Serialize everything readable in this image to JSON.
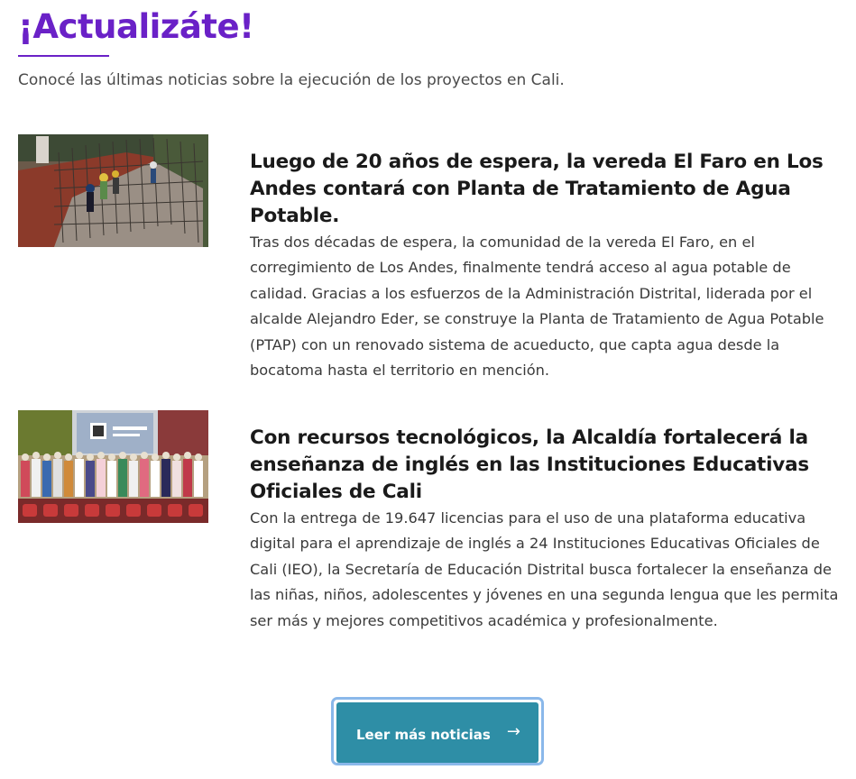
{
  "section": {
    "title": "¡Actualizáte!",
    "subtitle": "Conocé las últimas noticias sobre la ejecución de los proyectos en Cali."
  },
  "news": [
    {
      "title": "Luego de 20 años de espera, la vereda El Faro en Los Andes contará con Planta de Tratamiento de Agua Potable.",
      "body": "Tras dos décadas de espera, la comunidad de la vereda El Faro, en el corregimiento de Los Andes, finalmente tendrá acceso al agua potable de calidad. Gracias a los esfuerzos de la Administración Distrital, liderada por el alcalde Alejandro Eder, se construye la Planta de Tratamiento de Agua Potable (PTAP) con un renovado sistema de acueducto, que capta agua desde la bocatoma hasta el territorio en mención.",
      "image": "construction-site-photo"
    },
    {
      "title": "Con recursos tecnológicos, la Alcaldía fortalecerá la enseñanza de inglés en las Instituciones Educativas Oficiales de Cali",
      "body": "Con la entrega de 19.647 licencias para el uso de una plataforma educativa digital para el aprendizaje de inglés a 24 Instituciones Educativas Oficiales de Cali (IEO), la Secretaría de Educación Distrital busca fortalecer la enseñanza de las niñas, niños, adolescentes y jóvenes en una segunda lengua que les permita ser más y mejores competitivos académica y profesionalmente.",
      "image": "group-photo-auditorium"
    }
  ],
  "cta": {
    "label": "Leer más noticias",
    "icon": "arrow-right-icon",
    "arrow": "→"
  },
  "colors": {
    "title": "#6a21c7",
    "button": "#2e8ea6",
    "button_border": "#8ab8ea"
  }
}
